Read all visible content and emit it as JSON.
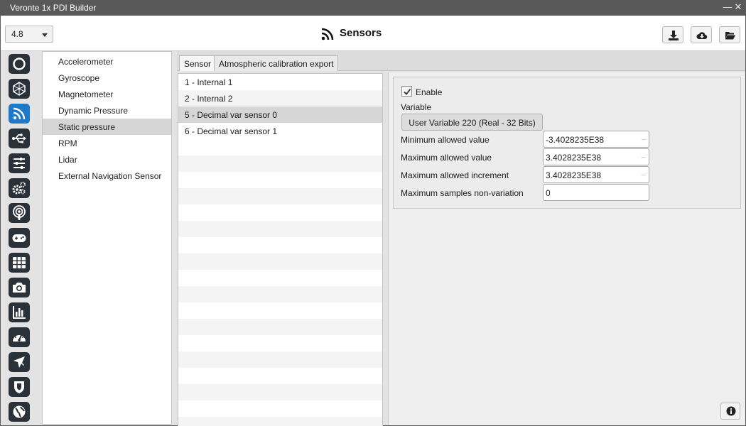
{
  "window": {
    "title": "Veronte 1x PDI Builder",
    "minimize_glyph": "—",
    "close_glyph": "✕"
  },
  "header": {
    "version": "4.8",
    "title": "Sensors",
    "title_icon": "rss-icon",
    "actions": [
      "download-icon",
      "cloud-download-icon",
      "folder-open-icon"
    ]
  },
  "iconbar": {
    "icons": [
      "power-ring-icon",
      "cube-icon",
      "rss-icon",
      "usb-icon",
      "sliders-icon",
      "gears-icon",
      "podcast-icon",
      "gamepad-icon",
      "grid-icon",
      "camera-icon",
      "bar-chart-icon",
      "gauge-icon",
      "plane-icon",
      "shield-icon",
      "globe-icon"
    ],
    "active": "rss-icon"
  },
  "menu": {
    "items": [
      "Accelerometer",
      "Gyroscope",
      "Magnetometer",
      "Dynamic Pressure",
      "Static pressure",
      "RPM",
      "Lidar",
      "External Navigation Sensor"
    ],
    "selected": "Static pressure"
  },
  "tabs": {
    "items": [
      "Sensor",
      "Atmospheric calibration export"
    ],
    "active": "Sensor"
  },
  "sensor_list": {
    "items": [
      "1 - Internal 1",
      "2 - Internal 2",
      "5 - Decimal var sensor 0",
      "6 - Decimal var sensor 1"
    ],
    "selected": "5 - Decimal var sensor 0"
  },
  "detail": {
    "enable_label": "Enable",
    "enable_checked": true,
    "variable_label": "Variable",
    "variable_button": "User Variable 220 (Real - 32 Bits)",
    "min_label": "Minimum allowed value",
    "min_value": "-3.4028235E38",
    "max_label": "Maximum allowed value",
    "max_value": "3.4028235E38",
    "incr_label": "Maximum allowed increment",
    "incr_value": "3.4028235E38",
    "samples_label": "Maximum samples non-variation",
    "samples_value": "0",
    "field_suffix": "--"
  },
  "colors": {
    "titlebar": "#595959",
    "active_icon": "#1f78c8",
    "icon_bg": "#2a3138",
    "selection": "#d6d6d6"
  }
}
